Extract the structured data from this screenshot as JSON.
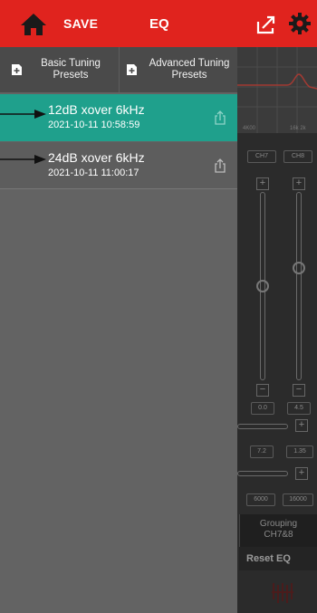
{
  "header": {
    "save_label": "SAVE",
    "title": "EQ",
    "home_icon": "home-icon",
    "export_icon": "export-icon",
    "settings_icon": "gear-icon",
    "bg_color": "#e0231e"
  },
  "drawer": {
    "tabs": [
      {
        "label_line1": "Basic Tuning",
        "label_line2": "Presets",
        "icon": "add-file-icon"
      },
      {
        "label_line1": "Advanced Tuning",
        "label_line2": "Presets",
        "icon": "add-file-icon"
      }
    ],
    "presets": [
      {
        "name": "12dB xover 6kHz",
        "date": "2021-10-11 10:58:59",
        "selected": true,
        "icon": "share-icon"
      },
      {
        "name": "24dB xover 6kHz",
        "date": "2021-10-11 11:00:17",
        "selected": false,
        "icon": "share-icon"
      }
    ],
    "selected_color": "#1fa08c"
  },
  "background": {
    "channels": [
      "CH7",
      "CH8"
    ],
    "gain_values": [
      "0.0",
      "4.5"
    ],
    "q_values": [
      "7.2",
      "1.35"
    ],
    "freq_values": [
      "6000",
      "16000"
    ],
    "graph_labels": [
      "4K00",
      "16k 2k"
    ],
    "grouping_line1": "Grouping",
    "grouping_line2": "CH7&8",
    "reset_label": "Reset EQ"
  }
}
